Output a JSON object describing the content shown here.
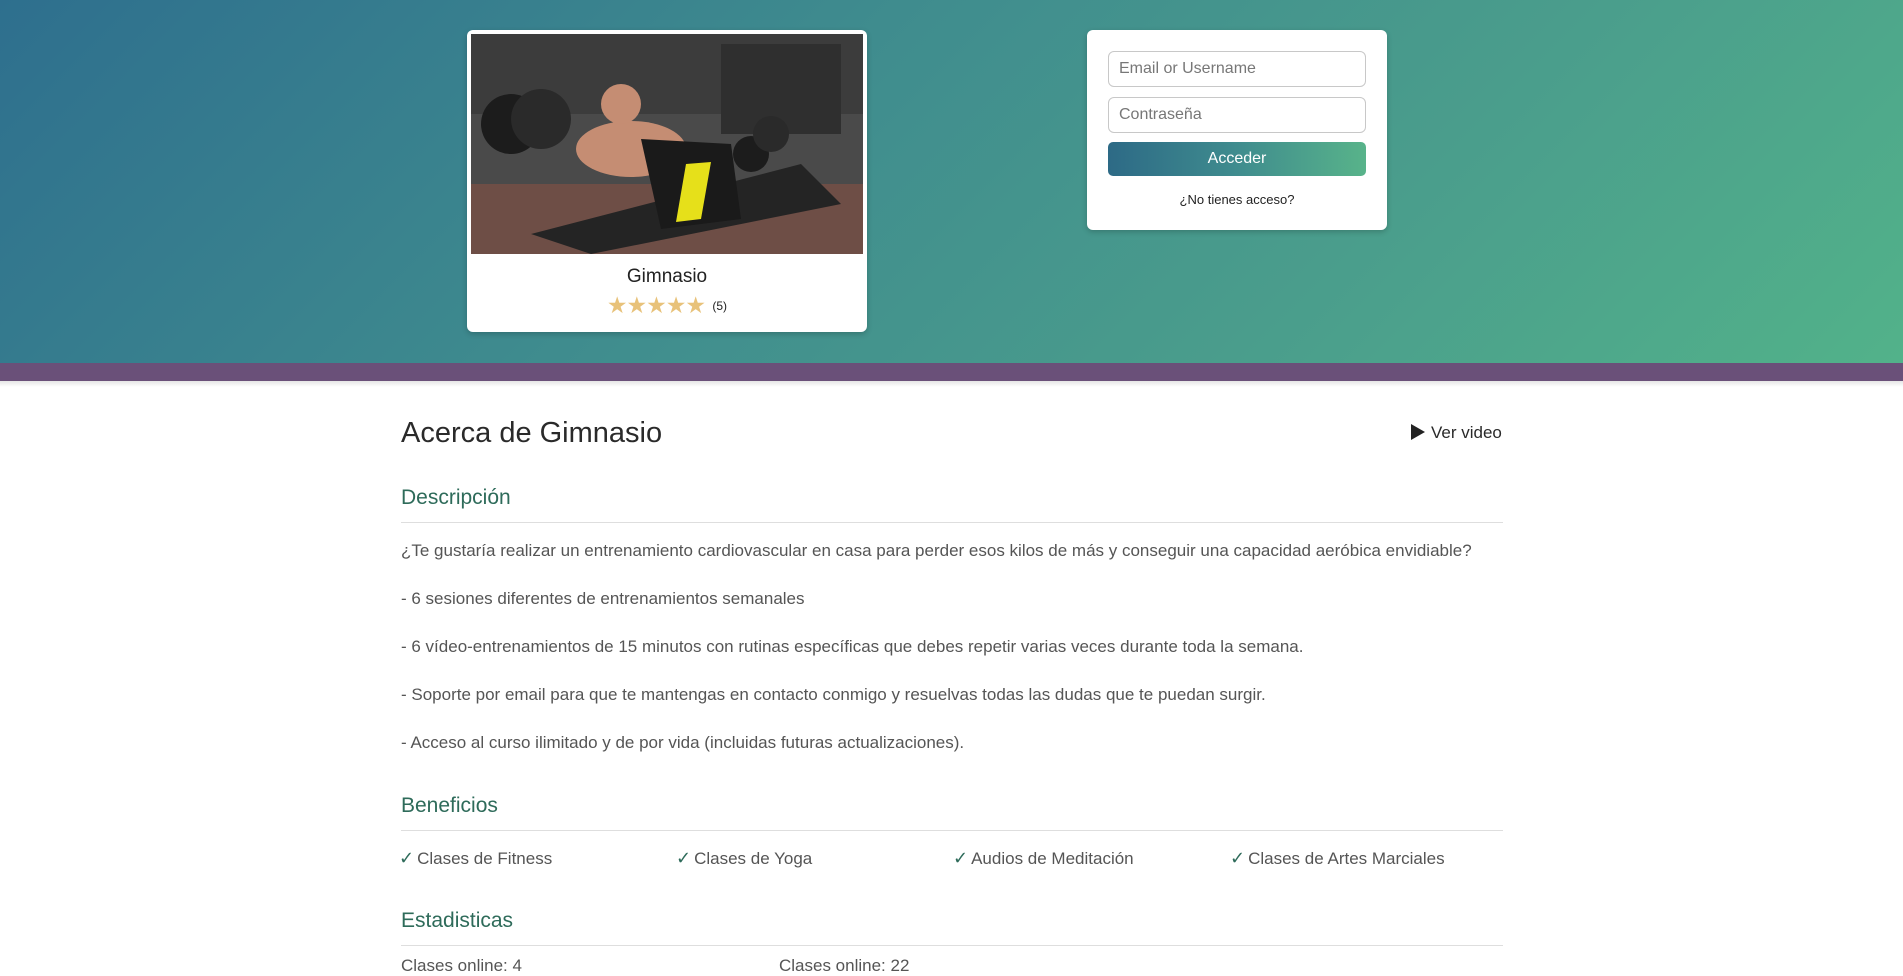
{
  "course": {
    "title": "Gimnasio",
    "rating_count": "(5)",
    "stars": 5
  },
  "login": {
    "username_placeholder": "Email or Username",
    "password_placeholder": "Contraseña",
    "submit_label": "Acceder",
    "no_access_link": "¿No tienes acceso?"
  },
  "about": {
    "title": "Acerca de Gimnasio",
    "video_link": "Ver video"
  },
  "description": {
    "heading": "Descripción",
    "lines": [
      "¿Te gustaría realizar un entrenamiento cardiovascular en casa para perder esos kilos de más y conseguir una capacidad aeróbica envidiable?",
      "- 6 sesiones diferentes de entrenamientos semanales",
      "- 6 vídeo-entrenamientos de 15 minutos con rutinas específicas que debes repetir varias veces durante toda la semana.",
      "- Soporte por email para que te mantengas en contacto conmigo y resuelvas todas las dudas que te puedan surgir.",
      "- Acceso al curso ilimitado y de por vida (incluidas futuras actualizaciones)."
    ]
  },
  "benefits": {
    "heading": "Beneficios",
    "items": [
      "Clases de Fitness",
      "Clases de Yoga",
      "Audios de Meditación",
      "Clases de Artes Marciales"
    ]
  },
  "stats": {
    "heading": "Estadisticas",
    "items": [
      "Clases online: 4",
      "Clases online: 22"
    ]
  },
  "colors": {
    "accent": "#2e6b5a",
    "stripe": "#6a5079",
    "star": "#e8c27a"
  }
}
